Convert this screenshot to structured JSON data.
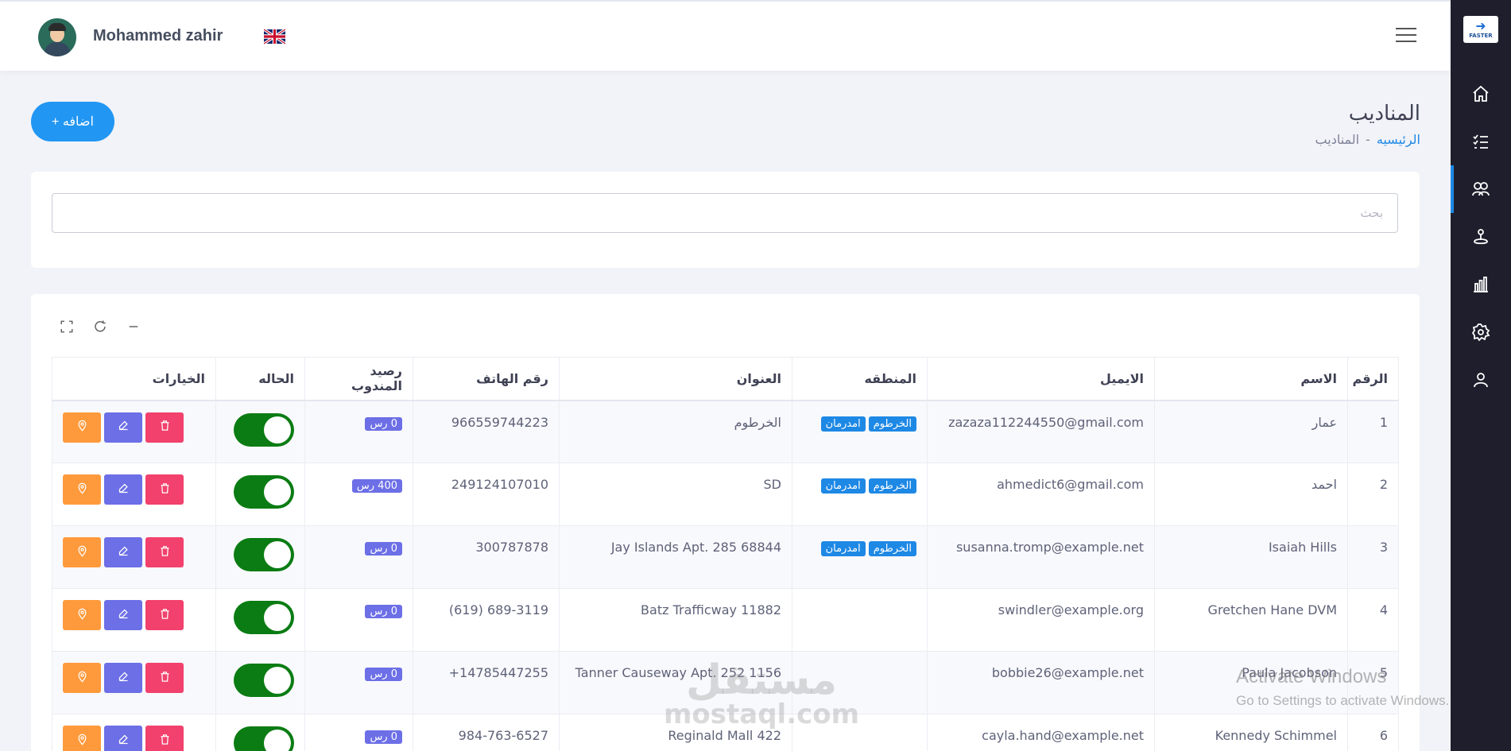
{
  "user": {
    "name": "Mohammed zahir"
  },
  "brand": {
    "logo_text": "FASTER"
  },
  "page": {
    "title": "المناديب",
    "breadcrumb_home": "الرئيسيه",
    "breadcrumb_sep": "-",
    "breadcrumb_current": "المناديب"
  },
  "actions": {
    "add_label": "+ اضافه"
  },
  "search": {
    "placeholder": "بحث"
  },
  "table": {
    "headers": [
      "الرقم",
      "الاسم",
      "الايميل",
      "المنطقه",
      "العنوان",
      "رقم الهاتف",
      "رصيد المندوب",
      "الحاله",
      "الخيارات"
    ],
    "rows": [
      {
        "num": "1",
        "name": "عمار",
        "email": "zazaza112244550@gmail.com",
        "regions": [
          "الخرطوم",
          "امدرمان"
        ],
        "address": "الخرطوم",
        "phone": "966559744223",
        "balance": "0 رس",
        "active": true
      },
      {
        "num": "2",
        "name": "احمد",
        "email": "ahmedict6@gmail.com",
        "regions": [
          "الخرطوم",
          "امدرمان"
        ],
        "address": "SD",
        "phone": "249124107010",
        "balance": "400 رس",
        "active": true
      },
      {
        "num": "3",
        "name": "Isaiah Hills",
        "email": "susanna.tromp@example.net",
        "regions": [
          "الخرطوم",
          "امدرمان"
        ],
        "address": "Jay Islands Apt. 285 68844",
        "phone": "300787878",
        "balance": "0 رس",
        "active": true
      },
      {
        "num": "4",
        "name": "Gretchen Hane DVM",
        "email": "swindler@example.org",
        "regions": [],
        "address": "Batz Trafficway 11882",
        "phone": "689-3119 (619)",
        "balance": "0 رس",
        "active": true
      },
      {
        "num": "5",
        "name": "Paula Jacobson",
        "email": "bobbie26@example.net",
        "regions": [],
        "address": "Tanner Causeway Apt. 252 1156",
        "phone": "14785447255+",
        "balance": "0 رس",
        "active": true
      },
      {
        "num": "6",
        "name": "Kennedy Schimmel",
        "email": "cayla.hand@example.net",
        "regions": [],
        "address": "Reginald Mall 422",
        "phone": "984-763-6527",
        "balance": "0 رس",
        "active": true
      }
    ]
  },
  "icons": {
    "sidebar": [
      "home-icon",
      "checklist-icon",
      "users-icon",
      "courier-icon",
      "chart-icon",
      "settings-icon",
      "user-icon"
    ],
    "row_options": [
      "location-icon",
      "edit-icon",
      "delete-icon"
    ]
  },
  "colors": {
    "primary": "#2196f3",
    "sidebar": "#1e1e2d",
    "toggle_on": "#0a7c13",
    "delete": "#f1416c",
    "edit": "#6c6fe6",
    "location": "#ff9a3c"
  },
  "watermark": {
    "line1": "Activate Windows",
    "line2": "Go to Settings to activate Windows.",
    "mostaql_ar": "مستقل",
    "mostaql_en": "mostaql.com"
  }
}
